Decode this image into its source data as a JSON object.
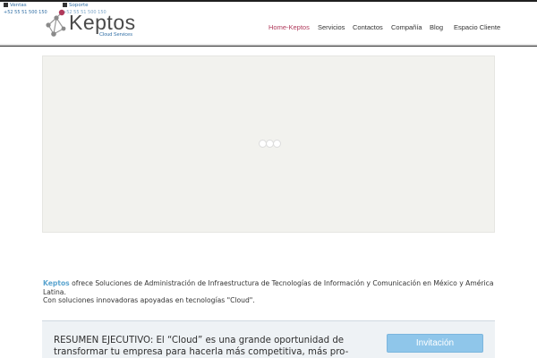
{
  "contact": {
    "ventas_label": "Ventas",
    "soporte_label": "Soporte",
    "ventas_phone": "+52 55 51 500 150",
    "soporte_phone": "+52 55 51 500 150"
  },
  "logo": {
    "brand": "Keptos",
    "tagline": "Cloud Services"
  },
  "nav": {
    "items": [
      {
        "label": "Home-Keptos",
        "active": true
      },
      {
        "label": "Servicios",
        "active": false
      },
      {
        "label": "Contactos",
        "active": false
      },
      {
        "label": "Compañía",
        "active": false
      },
      {
        "label": "Blog",
        "active": false
      },
      {
        "label": "Espacio Cliente",
        "active": false
      }
    ]
  },
  "intro": {
    "brand_word": "Keptos",
    "line1_rest": " ofrece Soluciones de Administración de Infraestructura de Tecnologías de Información y Comunicación en México y América Latina.",
    "line2": "Con soluciones innovadoras apoyadas en tecnologías \"Cloud\"."
  },
  "resumen": {
    "text": "RESUMEN EJECUTIVO: El “Cloud” es una grande oportunidad de transformar tu empresa para hacerla más competitiva, más pro-",
    "button_label": "Invitación"
  },
  "colors": {
    "accent_active": "#b03a5b",
    "link_blue": "#2e6da4",
    "brand_blue": "#5aa4cf",
    "button_blue": "#8fc6ea"
  }
}
